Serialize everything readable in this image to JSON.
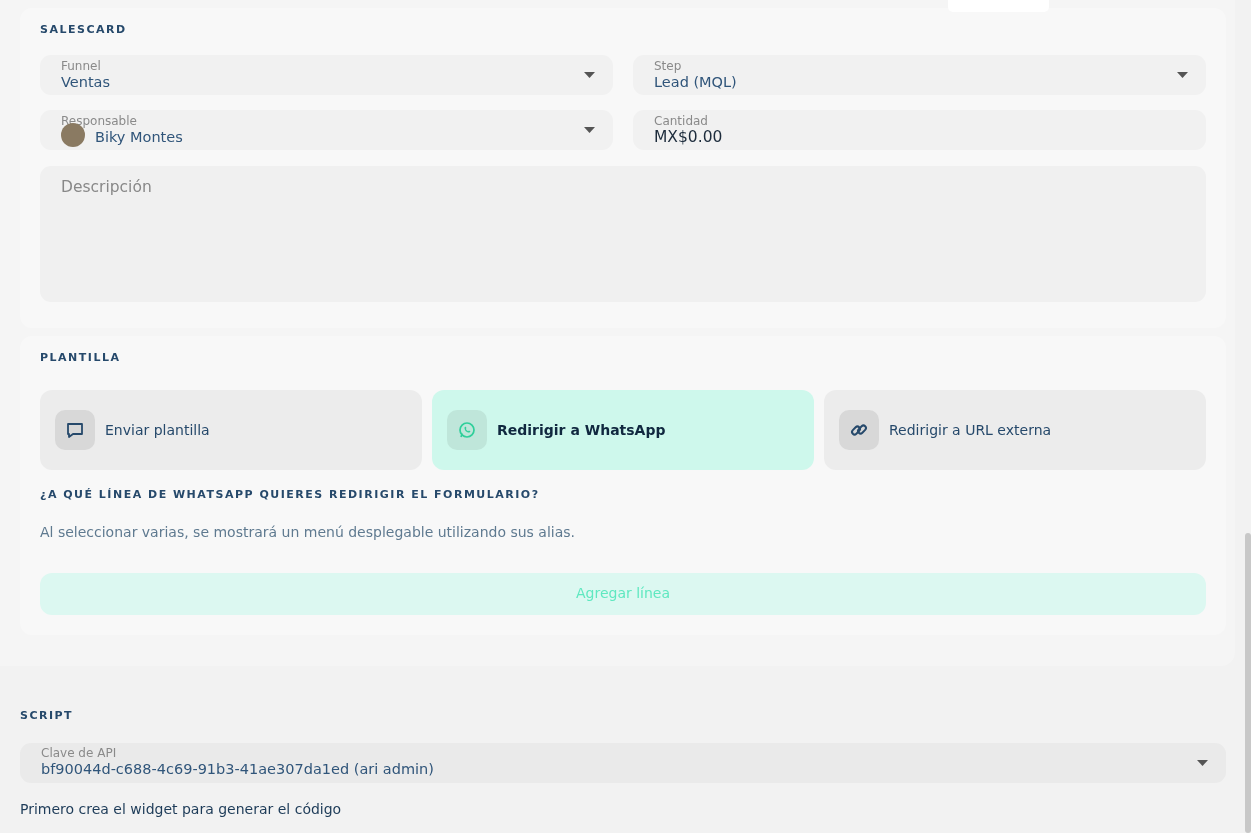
{
  "salescard": {
    "title": "SALESCARD",
    "fields": [
      {
        "kind": "select",
        "label": "Funnel",
        "value": "Ventas"
      },
      {
        "kind": "select",
        "label": "Step",
        "value": "Lead (MQL)"
      },
      {
        "kind": "person",
        "label": "Responsable",
        "value": "Biky Montes"
      },
      {
        "kind": "money",
        "label": "Cantidad",
        "value": "MX$0.00"
      }
    ],
    "description": {
      "placeholder": "Descripción"
    }
  },
  "plantilla": {
    "title": "PLANTILLA",
    "options": [
      {
        "kind": "chat",
        "label": "Enviar plantilla",
        "selected": false
      },
      {
        "kind": "whatsapp",
        "label": "Redirigir a WhatsApp",
        "selected": true
      },
      {
        "kind": "link",
        "label": "Redirigir a URL externa",
        "selected": false
      }
    ],
    "question": "¿A QUÉ LÍNEA DE WHATSAPP QUIERES REDIRIGIR EL FORMULARIO?",
    "hint": "Al seleccionar varias, se mostrará un menú desplegable utilizando sus alias.",
    "add_button": "Agregar línea"
  },
  "script": {
    "title": "SCRIPT",
    "field": {
      "label": "Clave de API",
      "value": "bf90044d-c688-4c69-91b3-41ae307da1ed (ari admin)"
    },
    "note": "Primero crea el widget para generar el código"
  }
}
